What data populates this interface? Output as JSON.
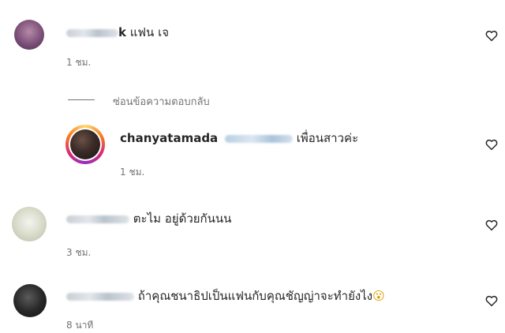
{
  "comments": [
    {
      "text": "แฟน เจ",
      "username_suffix": "k",
      "time": "1 ชม.",
      "hidden_replies_label": "ซ่อนข้อความตอบกลับ"
    },
    {
      "username": "chanyatamada",
      "text": "เพื่อนสาวค่ะ",
      "time": "1 ชม."
    },
    {
      "text": "ตะไม อยู่ด้วยกันนน",
      "time": "3 ชม."
    },
    {
      "text": "ถ้าคุณชนาธิปเป็นแฟนกับคุณชัญญ่าจะทำยังไง",
      "emoji": "😮",
      "time": "8 นาที"
    }
  ],
  "icons": {
    "like": "heart-outline-icon"
  }
}
